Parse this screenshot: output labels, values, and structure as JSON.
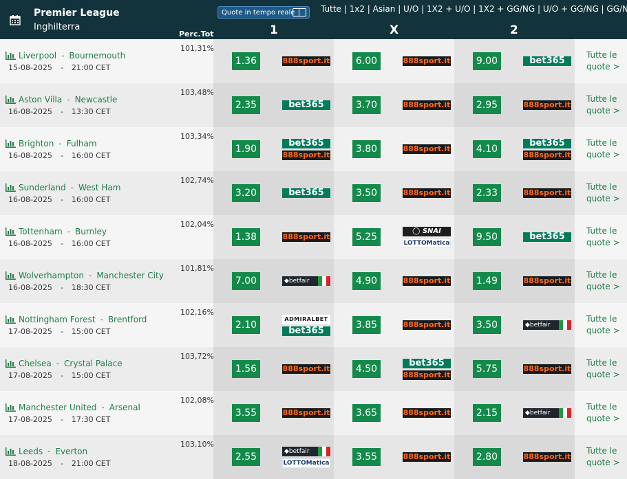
{
  "header": {
    "league": "Premier League",
    "country": "Inghilterra",
    "live_label": "Quote in tempo reale",
    "markets": "Tutte | 1x2 | Asian | U/O | 1X2 + U/O | 1X2 + GG/NG | U/O + GG/NG | GG/NG",
    "perc_label": "Perc.Tot",
    "col_1": "1",
    "col_x": "X",
    "col_2": "2"
  },
  "more": {
    "line1": "Tutte le",
    "line2": "quote >"
  },
  "bookmakers": {
    "888": "888sport.it",
    "bet365": "bet365",
    "betfair": "betfair",
    "snai": "SNAI",
    "lottomatica": "LOTTOMatica",
    "admiral": "ADMIRALBET"
  },
  "matches": [
    {
      "home": "Liverpool",
      "away": "Bournemouth",
      "date": "15-08-2025",
      "time": "21:00 CET",
      "perc": "101,31%",
      "odds": [
        {
          "v": "1.36",
          "bk": [
            "888"
          ]
        },
        {
          "v": "6.00",
          "bk": [
            "888"
          ]
        },
        {
          "v": "9.00",
          "bk": [
            "bet365"
          ]
        }
      ]
    },
    {
      "home": "Aston Villa",
      "away": "Newcastle",
      "date": "16-08-2025",
      "time": "13:30 CET",
      "perc": "103,48%",
      "odds": [
        {
          "v": "2.35",
          "bk": [
            "bet365"
          ]
        },
        {
          "v": "3.70",
          "bk": [
            "888"
          ]
        },
        {
          "v": "2.95",
          "bk": [
            "888"
          ]
        }
      ]
    },
    {
      "home": "Brighton",
      "away": "Fulham",
      "date": "16-08-2025",
      "time": "16:00 CET",
      "perc": "103,34%",
      "odds": [
        {
          "v": "1.90",
          "bk": [
            "bet365",
            "888"
          ]
        },
        {
          "v": "3.80",
          "bk": [
            "888"
          ]
        },
        {
          "v": "4.10",
          "bk": [
            "bet365",
            "888"
          ]
        }
      ]
    },
    {
      "home": "Sunderland",
      "away": "West Ham",
      "date": "16-08-2025",
      "time": "16:00 CET",
      "perc": "102,74%",
      "odds": [
        {
          "v": "3.20",
          "bk": [
            "bet365"
          ]
        },
        {
          "v": "3.50",
          "bk": [
            "888"
          ]
        },
        {
          "v": "2.33",
          "bk": [
            "888"
          ]
        }
      ]
    },
    {
      "home": "Tottenham",
      "away": "Burnley",
      "date": "16-08-2025",
      "time": "16:00 CET",
      "perc": "102,04%",
      "odds": [
        {
          "v": "1.38",
          "bk": [
            "888"
          ]
        },
        {
          "v": "5.25",
          "bk": [
            "snai",
            "lottomatica"
          ]
        },
        {
          "v": "9.50",
          "bk": [
            "bet365"
          ]
        }
      ]
    },
    {
      "home": "Wolverhampton",
      "away": "Manchester City",
      "date": "16-08-2025",
      "time": "18:30 CET",
      "perc": "101,81%",
      "odds": [
        {
          "v": "7.00",
          "bk": [
            "betfair"
          ]
        },
        {
          "v": "4.90",
          "bk": [
            "888"
          ]
        },
        {
          "v": "1.49",
          "bk": [
            "888"
          ]
        }
      ]
    },
    {
      "home": "Nottingham Forest",
      "away": "Brentford",
      "date": "17-08-2025",
      "time": "15:00 CET",
      "perc": "102,16%",
      "odds": [
        {
          "v": "2.10",
          "bk": [
            "admiral",
            "bet365"
          ]
        },
        {
          "v": "3.85",
          "bk": [
            "888"
          ]
        },
        {
          "v": "3.50",
          "bk": [
            "betfair"
          ]
        }
      ]
    },
    {
      "home": "Chelsea",
      "away": "Crystal Palace",
      "date": "17-08-2025",
      "time": "15:00 CET",
      "perc": "103,72%",
      "odds": [
        {
          "v": "1.56",
          "bk": [
            "888"
          ]
        },
        {
          "v": "4.50",
          "bk": [
            "bet365",
            "888"
          ]
        },
        {
          "v": "5.75",
          "bk": [
            "888"
          ]
        }
      ]
    },
    {
      "home": "Manchester United",
      "away": "Arsenal",
      "date": "17-08-2025",
      "time": "17:30 CET",
      "perc": "102,08%",
      "odds": [
        {
          "v": "3.55",
          "bk": [
            "888"
          ]
        },
        {
          "v": "3.65",
          "bk": [
            "888"
          ]
        },
        {
          "v": "2.15",
          "bk": [
            "betfair"
          ]
        }
      ]
    },
    {
      "home": "Leeds",
      "away": "Everton",
      "date": "18-08-2025",
      "time": "21:00 CET",
      "perc": "103,10%",
      "odds": [
        {
          "v": "2.55",
          "bk": [
            "betfair",
            "lottomatica"
          ]
        },
        {
          "v": "3.55",
          "bk": [
            "888"
          ]
        },
        {
          "v": "2.80",
          "bk": [
            "888"
          ]
        }
      ]
    }
  ]
}
